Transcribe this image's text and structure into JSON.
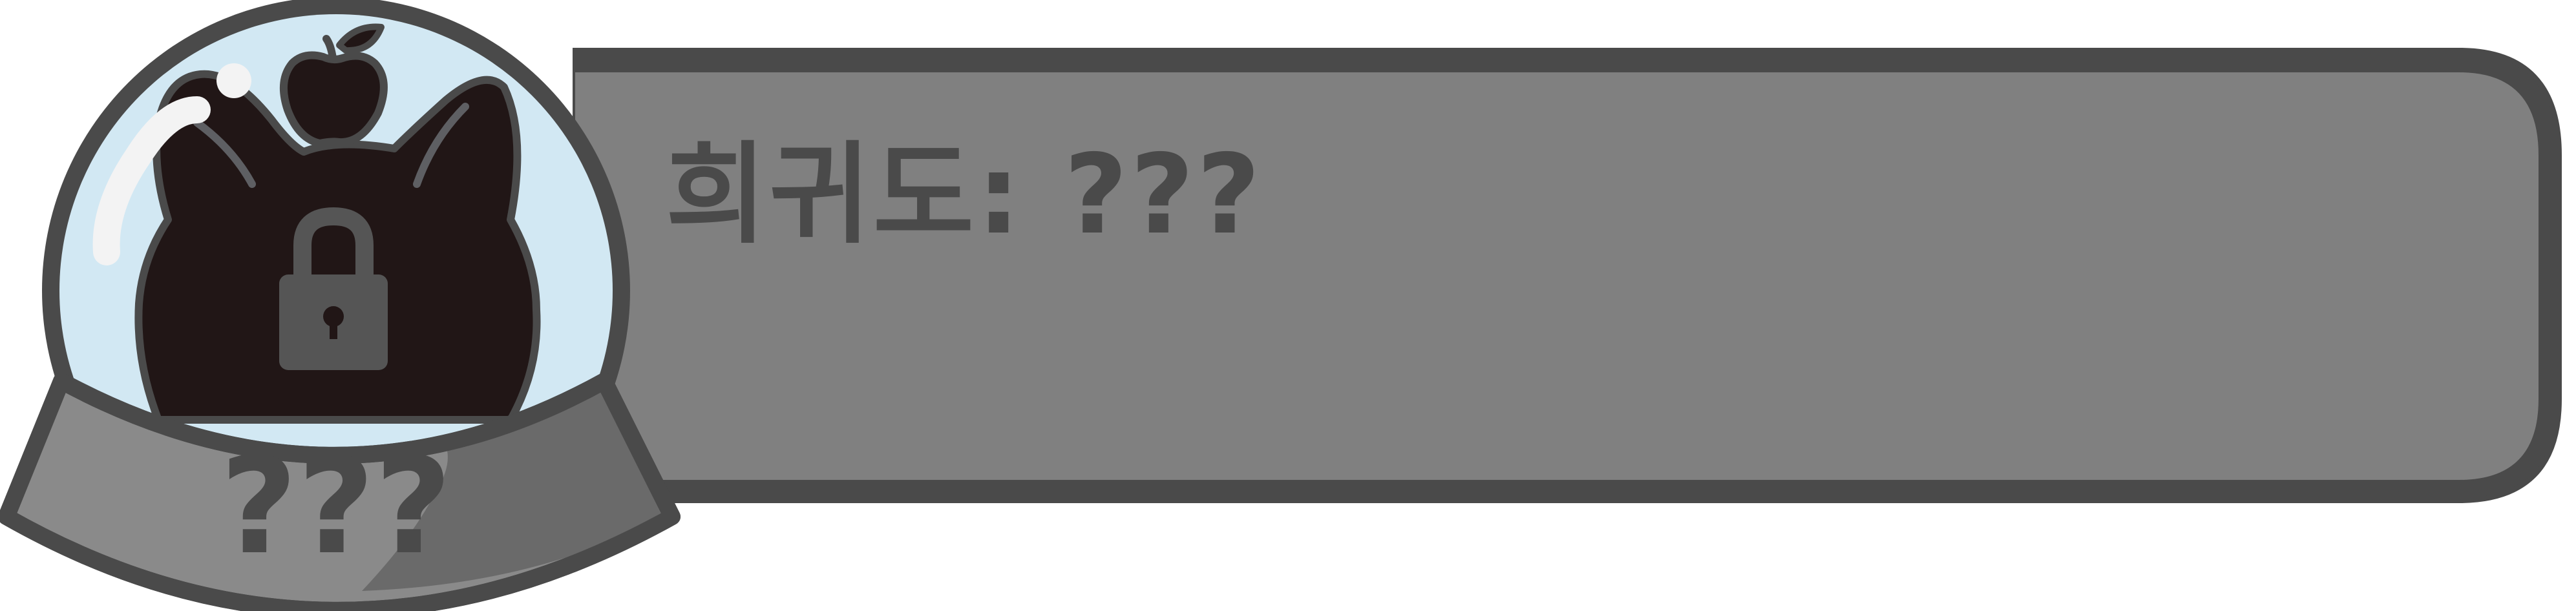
{
  "card": {
    "rarity_label": "희귀도: ???",
    "base_label": "???",
    "locked": true,
    "colors": {
      "outline": "#4a4a4a",
      "banner_fill": "#808080",
      "globe_glass": "#d2e8f3",
      "silhouette": "#211616",
      "base_light": "#8a8a8a",
      "base_dark": "#6a6a6a",
      "lock_body": "#555555"
    },
    "icons": {
      "lock": "padlock-icon",
      "silhouette": "hidden-creature-silhouette",
      "fruit": "apple-icon"
    }
  }
}
